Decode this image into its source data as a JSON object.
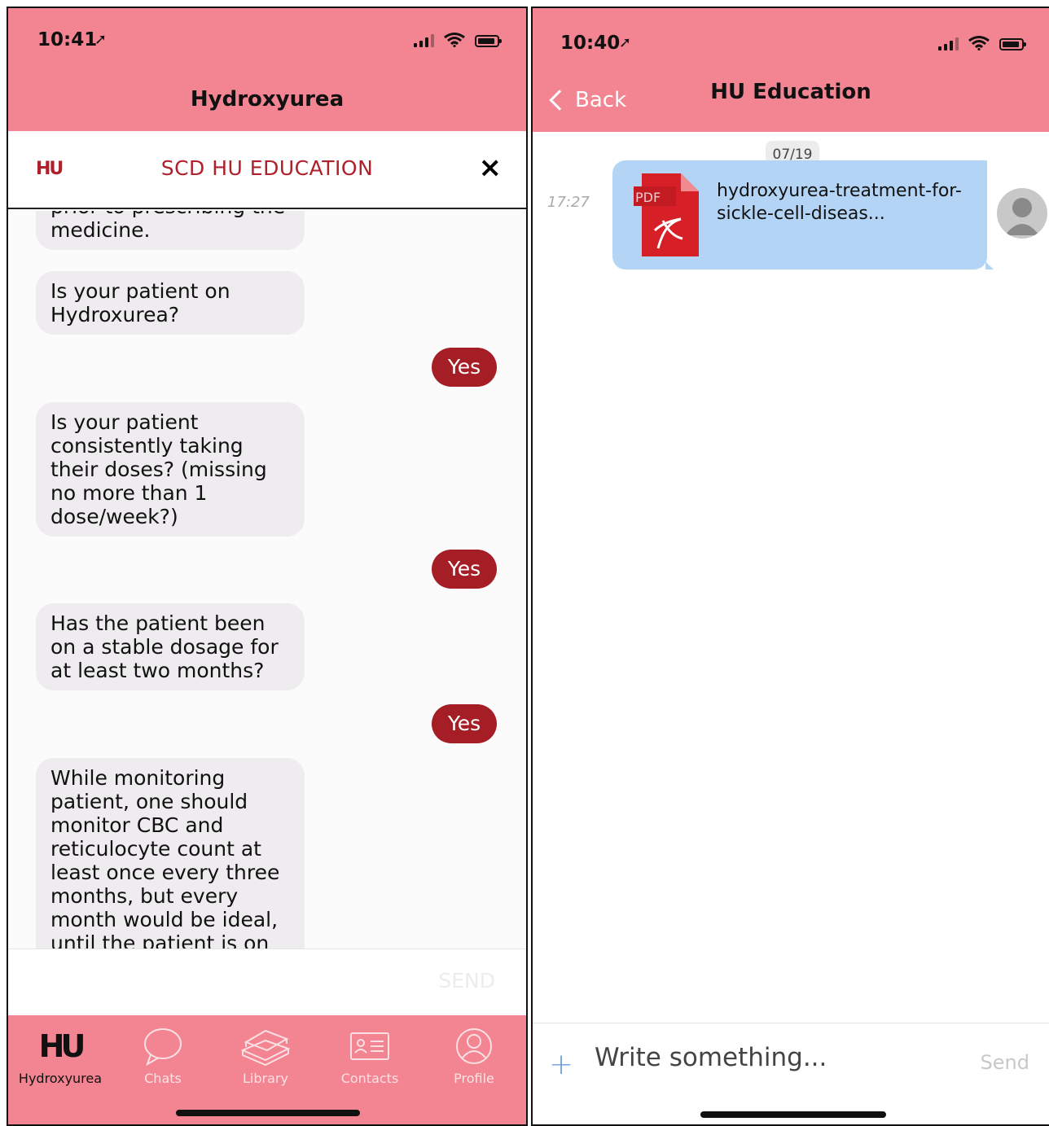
{
  "left": {
    "status": {
      "time": "10:41"
    },
    "header_title": "Hydroxyurea",
    "chatbar": {
      "logo": "HU",
      "title": "SCD HU EDUCATION",
      "close_icon": "×"
    },
    "messages": {
      "m0": "prior to prescribing the medicine.",
      "m1": "Is your patient on Hydroxurea?",
      "r1": "Yes",
      "m2": "Is your patient consistently taking their doses? (missing no more than 1 dose/week?)",
      "r2": "Yes",
      "m3": "Has the patient been on a stable dosage for at least two months?",
      "r3": "Yes",
      "m4": "While monitoring patient, one should monitor CBC and reticulocyte count at least once every three months, but every month would be ideal, until the patient is on"
    },
    "send_label": "SEND",
    "tabs": {
      "hydroxyurea": "Hydroxyurea",
      "hydroxyurea_logo": "HU",
      "chats": "Chats",
      "library": "Library",
      "contacts": "Contacts",
      "profile": "Profile"
    },
    "colors": {
      "header": "#f38592",
      "reply": "#a51d25",
      "brand": "#b0202a"
    }
  },
  "right": {
    "status": {
      "time": "10:40"
    },
    "back_label": "Back",
    "header_title": "HU Education",
    "date": "07/19",
    "msg_time": "17:27",
    "file": {
      "type_label": "PDF",
      "name": "hydroxyurea-treatment-for-sickle-cell-diseas..."
    },
    "composer": {
      "placeholder": "Write something...",
      "send_label": "Send"
    },
    "colors": {
      "bubble": "#b3d4f5",
      "pdf": "#d61f26"
    }
  }
}
